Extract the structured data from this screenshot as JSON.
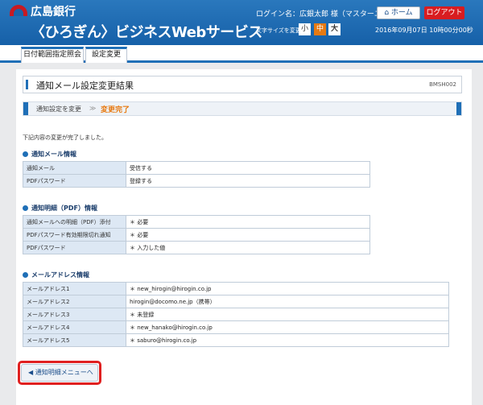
{
  "header": {
    "bank_name": "広島銀行",
    "service_name": "〈ひろぎん〉ビジネスWebサービス",
    "login_name": "ログイン名：広銀太郎 様（マスターユーザ）",
    "home_label": "ホーム",
    "logout_label": "ログアウト",
    "font_size_label": "文字サイズを変更",
    "font_small": "小",
    "font_medium": "中",
    "font_large": "大",
    "datetime": "2016年09月07日 10時00分00秒"
  },
  "tabs": [
    "日付範囲指定照会",
    "設定変更"
  ],
  "page": {
    "title": "通知メール設定変更結果",
    "screen_id": "BMSH002",
    "step1": "通知設定を変更",
    "step_arrow": "≫",
    "step2": "変更完了",
    "message": "下記内容の変更が完了しました。"
  },
  "sections": [
    {
      "title": "通知メール情報",
      "rows": [
        {
          "k": "通知メール",
          "v": "受信する"
        },
        {
          "k": "PDFパスワード",
          "v": "登録する"
        }
      ]
    },
    {
      "title": "通知明細（PDF）情報",
      "rows": [
        {
          "k": "通知メールへの明細（PDF）添付",
          "v": "＊ 必要"
        },
        {
          "k": "PDFパスワード有効期限切れ通知",
          "v": "＊ 必要"
        },
        {
          "k": "PDFパスワード",
          "v": "＊ 入力した値"
        }
      ]
    },
    {
      "title": "メールアドレス情報",
      "rows": [
        {
          "k": "メールアドレス1",
          "v": "＊ new_hirogin@hirogin.co.jp"
        },
        {
          "k": "メールアドレス2",
          "v": "hirogin@docomo.ne.jp（携帯）"
        },
        {
          "k": "メールアドレス3",
          "v": "＊ 未登録"
        },
        {
          "k": "メールアドレス4",
          "v": "＊ new_hanako@hirogin.co.jp"
        },
        {
          "k": "メールアドレス5",
          "v": "＊ saburo@hirogin.co.jp"
        }
      ]
    }
  ],
  "back_button": "通知明細メニューへ",
  "colors": {
    "brand": "#1f6fb7",
    "accent": "#e77a12",
    "logout": "#d81c20"
  }
}
